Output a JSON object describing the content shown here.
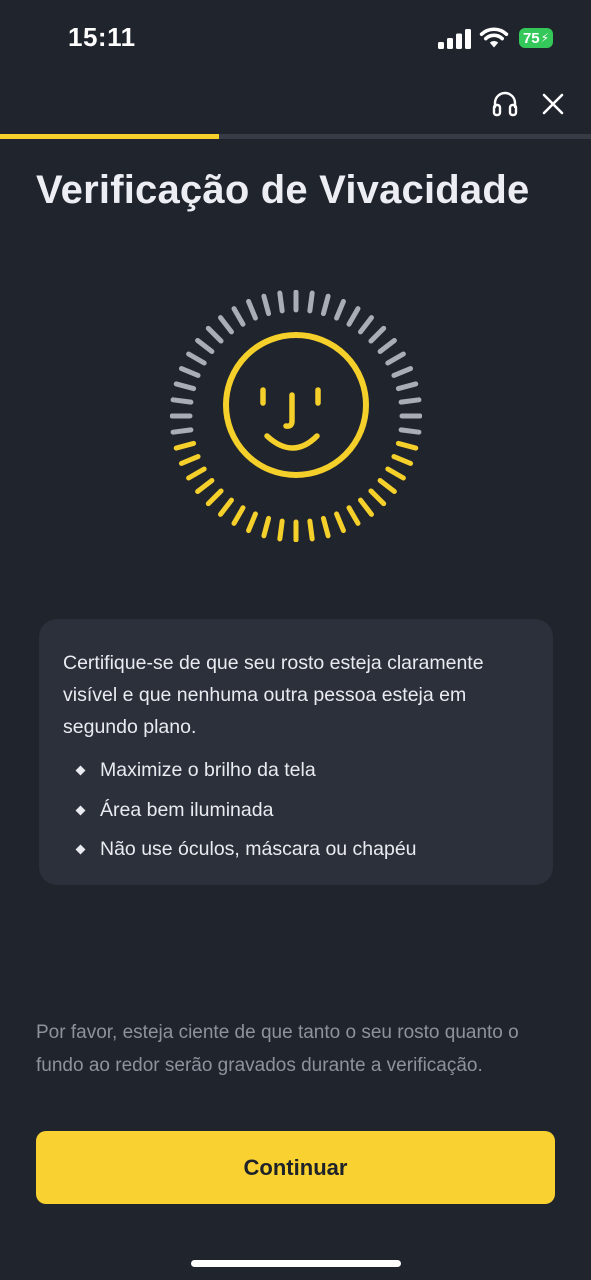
{
  "status_bar": {
    "time": "15:11",
    "battery_level": "75",
    "battery_color": "#34c759",
    "icons": [
      "cellular-signal-icon",
      "wifi-icon",
      "battery-charging-icon"
    ]
  },
  "header": {
    "support_icon": "headset-icon",
    "close_icon": "close-icon"
  },
  "progress": {
    "fraction": 0.37,
    "color": "#f5cf2a"
  },
  "page": {
    "title": "Verificação de Vivacidade"
  },
  "face_graphic": {
    "icon": "smiley-face-icon",
    "accent_color": "#f5cf2a",
    "inactive_color": "#a9adb6",
    "highlighted_ticks_fraction": 0.42
  },
  "info_card": {
    "text": "Certifique-se de que seu rosto esteja claramente visível e que nenhuma outra pessoa esteja em segundo plano.",
    "tips": [
      "Maximize o brilho da tela",
      "Área bem iluminada",
      "Não use óculos, máscara ou chapéu"
    ]
  },
  "notice": "Por favor, esteja ciente de que tanto o seu rosto quanto o fundo ao redor serão gravados durante a verificação.",
  "continue_button": {
    "label": "Continuar",
    "color": "#f9d231"
  }
}
